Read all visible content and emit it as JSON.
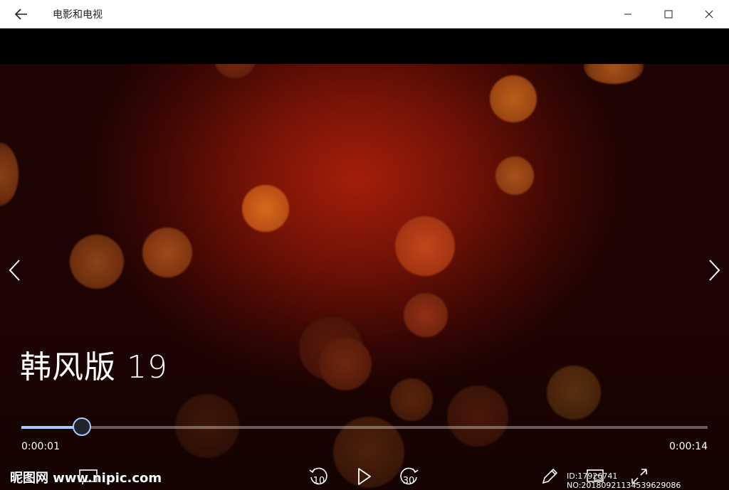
{
  "window": {
    "title": "电影和电视",
    "icons": {
      "back": "back-arrow-icon",
      "minimize": "minimize-icon",
      "maximize": "maximize-icon",
      "close": "close-icon"
    }
  },
  "player": {
    "video_title": "韩风版 19",
    "progress": 0.088,
    "time_elapsed": "0:00:01",
    "time_total": "0:00:14",
    "skip_back_seconds": "10",
    "skip_forward_seconds": "30",
    "colors": {
      "accent": "#a8c8ff",
      "background_center": "#a31e0a",
      "background_edge": "#1e0402"
    }
  },
  "watermark": {
    "left": "昵图网 www.nipic.com",
    "right": "ID:17926741 NO:20180921134539629086"
  }
}
